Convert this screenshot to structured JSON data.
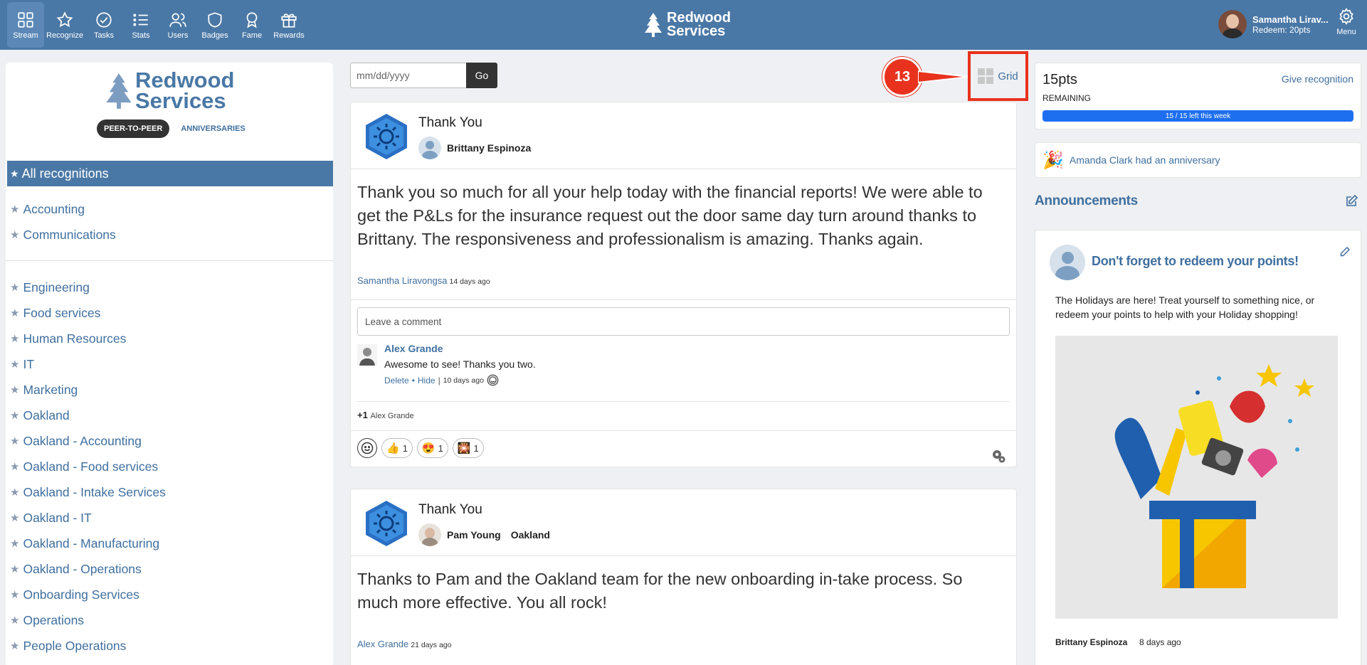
{
  "nav": {
    "items": [
      {
        "label": "Stream",
        "icon": "grid-icon"
      },
      {
        "label": "Recognize",
        "icon": "star-icon"
      },
      {
        "label": "Tasks",
        "icon": "check-circle-icon"
      },
      {
        "label": "Stats",
        "icon": "list-icon"
      },
      {
        "label": "Users",
        "icon": "users-icon"
      },
      {
        "label": "Badges",
        "icon": "shield-icon"
      },
      {
        "label": "Fame",
        "icon": "award-icon"
      },
      {
        "label": "Rewards",
        "icon": "gift-icon"
      }
    ],
    "menu_label": "Menu"
  },
  "brand": {
    "line1": "Redwood",
    "line2": "Services"
  },
  "user": {
    "name": "Samantha Lirav...",
    "redeem": "Redeem: 20pts"
  },
  "sidebar": {
    "tab_peer": "PEER-TO-PEER",
    "tab_anniv": "ANNIVERSARIES",
    "all_label": "All recognitions",
    "group1": [
      "Accounting",
      "Communications"
    ],
    "group2": [
      "Engineering",
      "Food services",
      "Human Resources",
      "IT",
      "Marketing",
      "Oakland",
      "Oakland - Accounting",
      "Oakland - Food services",
      "Oakland - Intake Services",
      "Oakland - IT",
      "Oakland - Manufacturing",
      "Oakland - Operations",
      "Onboarding Services",
      "Operations",
      "People Operations"
    ]
  },
  "filter": {
    "date_placeholder": "mm/dd/yyyy",
    "go_label": "Go",
    "grid_label": "Grid",
    "step": "13"
  },
  "posts": [
    {
      "title": "Thank You",
      "recipient": "Brittany Espinoza",
      "message": "Thank you so much for all your help today with the financial reports! We were able to get the P&Ls for the insurance request out the door same day turn around thanks to Brittany. The responsiveness and professionalism is amazing. Thanks again.",
      "author": "Samantha Liravongsa",
      "time": "14 days ago",
      "comment_placeholder": "Leave a comment",
      "comment": {
        "name": "Alex Grande",
        "text": "Awesome to see! Thanks you two.",
        "delete": "Delete",
        "hide": "Hide",
        "time": "10 days ago"
      },
      "plus_one": "+1",
      "plus_one_name": "Alex Grande",
      "reactions": [
        {
          "emoji": "👍",
          "count": "1"
        },
        {
          "emoji": "😍",
          "count": "1"
        },
        {
          "emoji": "🎇",
          "count": "1"
        }
      ]
    },
    {
      "title": "Thank You",
      "recipient": "Pam Young",
      "team": "Oakland",
      "message": "Thanks to Pam and the Oakland team for the new onboarding in-take process. So much more effective. You all rock!",
      "author": "Alex Grande",
      "time": "21 days ago"
    }
  ],
  "right": {
    "points": "15pts",
    "remaining": "REMAINING",
    "give": "Give recognition",
    "progress_label": "15 / 15 left this week",
    "progress_fraction": 1.0,
    "anniversary": "Amanda Clark had an anniversary",
    "announcements_title": "Announcements",
    "announcement": {
      "title": "Don't forget to redeem your points!",
      "text": "The Holidays are here! Treat yourself to something nice, or redeem your points to help with your Holiday shopping!",
      "author": "Brittany Espinoza",
      "time": "8 days ago"
    }
  },
  "colors": {
    "topbar": "#4a78a6",
    "link": "#3f6f9f",
    "highlight": "#e8321e",
    "progress": "#1e6ff0"
  }
}
